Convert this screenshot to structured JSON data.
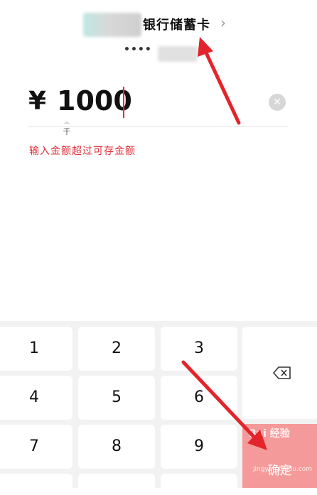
{
  "header": {
    "bank_name": "银行储蓄卡",
    "chevron": "›"
  },
  "card": {
    "dots": "••••"
  },
  "amount": {
    "currency": "¥",
    "value": "1000",
    "unit_hint": "千"
  },
  "error": {
    "message": "输入金额超过可存金额"
  },
  "keypad": {
    "keys": [
      "1",
      "2",
      "3",
      "4",
      "5",
      "6",
      "7",
      "8",
      "9"
    ],
    "backspace_icon": "backspace-icon",
    "confirm_label": "确定"
  },
  "watermark": {
    "text": "Bai",
    "text2": "经验",
    "sub": "jingyan.baidu.com"
  },
  "colors": {
    "accent": "#e0303a",
    "confirm_bg": "#f59a9a",
    "keypad_bg": "#f2f2f2"
  }
}
